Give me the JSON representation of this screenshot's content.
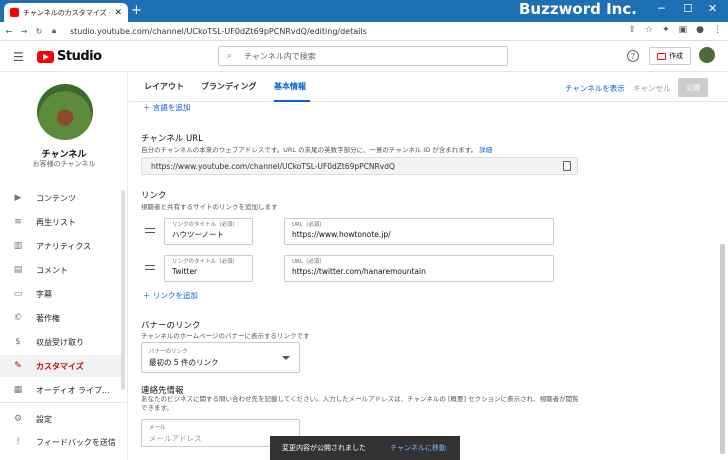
{
  "browser": {
    "tab_title": "チャンネルのカスタマイズ - YouTube S",
    "window_title": "Buzzword Inc.",
    "url": "studio.youtube.com/channel/UCkoTSL-UF0dZt69pPCNRvdQ/editing/details"
  },
  "header": {
    "logo_text": "Studio",
    "search_placeholder": "チャンネル内で検索",
    "create_label": "作成"
  },
  "channel": {
    "name": "チャンネル",
    "subtitle": "お客様のチャンネル"
  },
  "sidebar": {
    "items": [
      {
        "label": "コンテンツ",
        "icon": "content-icon"
      },
      {
        "label": "再生リスト",
        "icon": "playlist-icon"
      },
      {
        "label": "アナリティクス",
        "icon": "analytics-icon"
      },
      {
        "label": "コメント",
        "icon": "comment-icon"
      },
      {
        "label": "字幕",
        "icon": "subtitles-icon"
      },
      {
        "label": "著作権",
        "icon": "copyright-icon"
      },
      {
        "label": "収益受け取り",
        "icon": "dollar-icon"
      },
      {
        "label": "カスタマイズ",
        "icon": "customize-icon"
      },
      {
        "label": "オーディオ ライブ...",
        "icon": "audio-library-icon"
      }
    ],
    "settings_label": "設定",
    "feedback_label": "フィードバックを送信"
  },
  "tabs": {
    "layout": "レイアウト",
    "branding": "ブランディング",
    "basic": "基本情報"
  },
  "actions": {
    "view_channel": "チャンネルを表示",
    "cancel": "キャンセル",
    "publish": "公開"
  },
  "add_language": "言語を追加",
  "channel_url": {
    "title": "チャンネル URL",
    "desc": "自分のチャンネルの本来のウェブアドレスです。URL の末尾の英数字部分に、一意のチャンネル ID が含まれます。",
    "desc_link": "詳細",
    "value": "https://www.youtube.com/channel/UCkoTSL-UF0dZt69pPCNRvdQ"
  },
  "links": {
    "title": "リンク",
    "desc": "視聴者と共有するサイトのリンクを追加します",
    "title_label": "リンクのタイトル（必須）",
    "url_label": "URL（必須）",
    "rows": [
      {
        "title": "ハウツーノート",
        "url": "https://www.howtonote.jp/"
      },
      {
        "title": "Twitter",
        "url": "https://twitter.com/hanaremountain"
      }
    ],
    "add_label": "リンクを追加"
  },
  "banner_link": {
    "title": "バナーのリンク",
    "desc": "チャンネルのホームページのバナーに表示するリンクです",
    "select_label": "バナーのリンク",
    "select_value": "最初の 5 件のリンク"
  },
  "contact": {
    "title": "連絡先情報",
    "desc": "あなたのビジネスに関する問い合わせ先を記載してください。入力したメールアドレスは、チャンネルの [概要] セクションに表示され、視聴者が閲覧できます。",
    "email_label": "メール",
    "email_placeholder": "メールアドレス"
  },
  "snackbar": {
    "message": "変更内容が公開されました",
    "action": "チャンネルに移動"
  }
}
